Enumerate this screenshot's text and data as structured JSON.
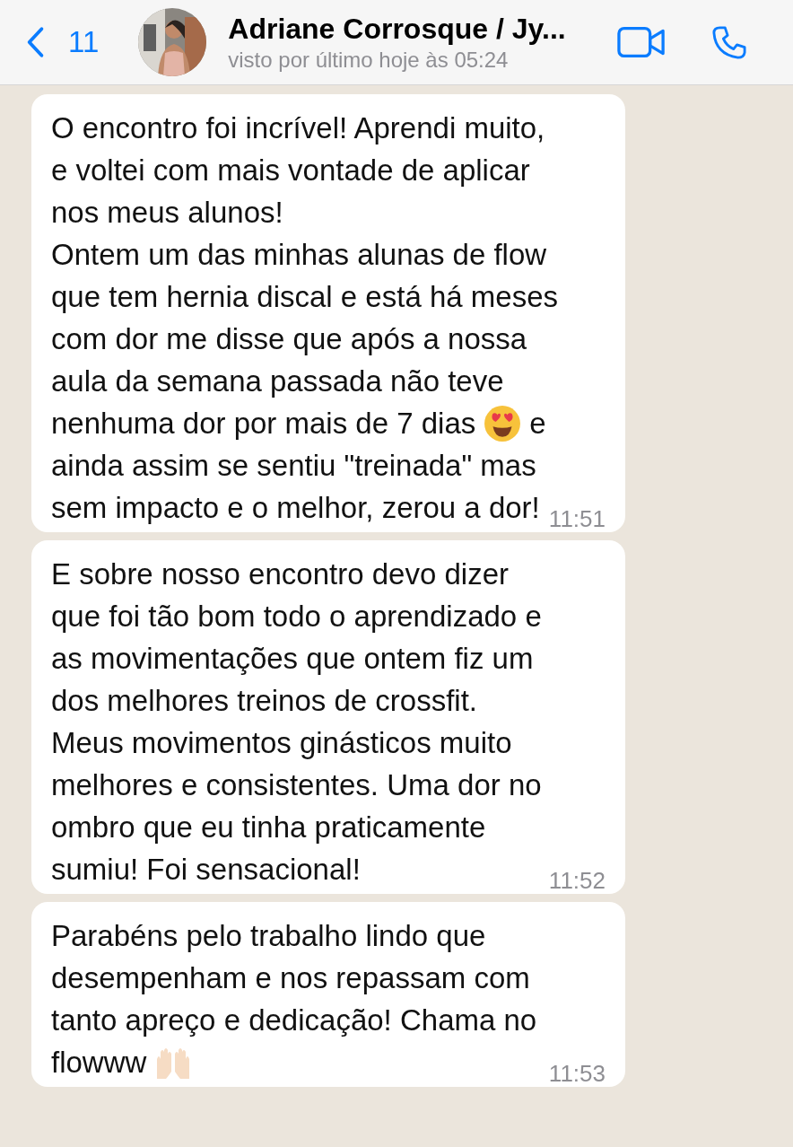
{
  "header": {
    "back_count": "11",
    "contact_name": "Adriane Corrosque / Jy...",
    "status": "visto por último hoje às 05:24"
  },
  "messages": [
    {
      "time": "11:51",
      "lines": [
        {
          "text": "O encontro foi incrível! Aprendi muito,"
        },
        {
          "text": "e voltei com mais vontade de aplicar"
        },
        {
          "text": "nos meus alunos!"
        },
        {
          "text": "Ontem um das minhas alunas de flow"
        },
        {
          "text": "que tem hernia discal e está há meses"
        },
        {
          "text": "com dor me disse que após a nossa"
        },
        {
          "text": "aula da semana passada não teve"
        },
        {
          "text": "nenhuma dor por mais de 7 dias",
          "kind": "hearteyes",
          "text_after": "e"
        },
        {
          "text": "ainda assim se sentiu \"treinada\" mas"
        },
        {
          "text": "sem impacto e o melhor, zerou a dor!"
        }
      ]
    },
    {
      "time": "11:52",
      "lines": [
        {
          "text": "E sobre nosso encontro devo dizer"
        },
        {
          "text": "que foi tão bom todo o aprendizado e"
        },
        {
          "text": "as movimentações que ontem fiz um"
        },
        {
          "text": "dos melhores treinos de crossfit."
        },
        {
          "text": "Meus movimentos ginásticos muito"
        },
        {
          "text": "melhores e consistentes. Uma dor no"
        },
        {
          "text": "ombro que eu tinha praticamente"
        },
        {
          "text": "sumiu! Foi sensacional!"
        }
      ]
    },
    {
      "time": "11:53",
      "lines": [
        {
          "text": "Parabéns pelo trabalho lindo que"
        },
        {
          "text": "desempenham e nos repassam com"
        },
        {
          "text": "tanto apreço e dedicação!  Chama no"
        },
        {
          "text": "flowww",
          "kind": "hands"
        }
      ]
    }
  ]
}
